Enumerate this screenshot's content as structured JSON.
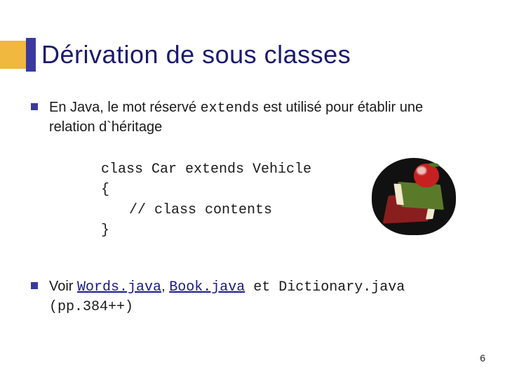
{
  "title": "Dérivation de sous classes",
  "bullets": {
    "b1_pre": "En Java, le mot réservé ",
    "b1_kw": "extends",
    "b1_post": " est utilisé pour établir une relation d`héritage",
    "b2_pre": "Voir ",
    "b2_link1": "Words.java",
    "b2_sep1": ", ",
    "b2_link2": "Book.java",
    "b2_mid": " et ",
    "b2_file3": "Dictionary.java",
    "b2_post": " (pp.384++)"
  },
  "code": {
    "l1": "class Car extends Vehicle",
    "l2": "{",
    "l3": "// class contents",
    "l4": "}"
  },
  "page_number": "6",
  "clipart": "books-and-apple"
}
